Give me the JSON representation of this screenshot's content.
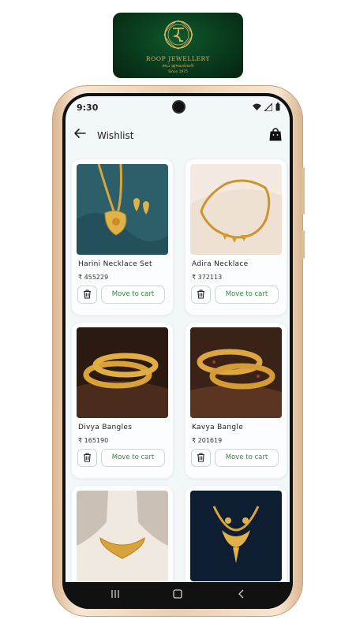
{
  "logo": {
    "brand": "ROOP JEWELLERY",
    "tamil": "ரூப் ஜுவல்லரி",
    "since": "Since 1975"
  },
  "status": {
    "time": "9:30"
  },
  "header": {
    "title": "Wishlist"
  },
  "products": [
    {
      "name": "Harini Necklace Set",
      "price": "₹ 455229",
      "cart_label": "Move to cart"
    },
    {
      "name": "Adira Necklace",
      "price": "₹ 372113",
      "cart_label": "Move to cart"
    },
    {
      "name": "Divya Bangles",
      "price": "₹ 165190",
      "cart_label": "Move to cart"
    },
    {
      "name": "Kavya Bangle",
      "price": "₹ 201619",
      "cart_label": "Move to cart"
    },
    {
      "name": "",
      "price": "",
      "cart_label": ""
    },
    {
      "name": "",
      "price": "",
      "cart_label": ""
    }
  ],
  "icons": {
    "back": "arrow-left-icon",
    "bag": "shopping-bag-icon",
    "delete": "trash-icon",
    "wifi": "wifi-icon",
    "signal": "signal-icon",
    "battery": "battery-icon"
  },
  "colors": {
    "accent": "#2e8b3e",
    "logo_bg": "#0a3f1f",
    "logo_gold": "#d8b56a",
    "app_bg": "#f2f7f9"
  }
}
